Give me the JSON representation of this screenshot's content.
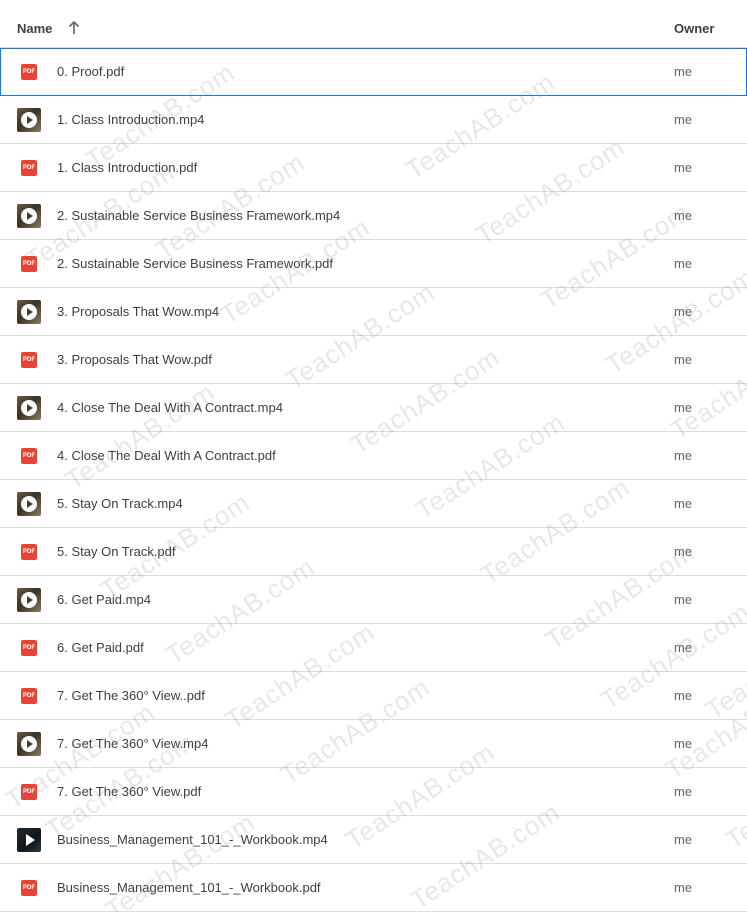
{
  "header": {
    "name_label": "Name",
    "owner_label": "Owner",
    "sort_icon": "arrow-upward-icon"
  },
  "files": [
    {
      "name": "0. Proof.pdf",
      "type": "pdf",
      "owner": "me",
      "selected": true
    },
    {
      "name": "1. Class Introduction.mp4",
      "type": "video",
      "owner": "me"
    },
    {
      "name": "1. Class Introduction.pdf",
      "type": "pdf",
      "owner": "me"
    },
    {
      "name": "2. Sustainable Service Business Framework.mp4",
      "type": "video",
      "owner": "me"
    },
    {
      "name": "2. Sustainable Service Business Framework.pdf",
      "type": "pdf",
      "owner": "me"
    },
    {
      "name": "3. Proposals That Wow.mp4",
      "type": "video",
      "owner": "me"
    },
    {
      "name": "3. Proposals That Wow.pdf",
      "type": "pdf",
      "owner": "me"
    },
    {
      "name": "4. Close The Deal With A Contract.mp4",
      "type": "video",
      "owner": "me"
    },
    {
      "name": "4. Close The Deal With A Contract.pdf",
      "type": "pdf",
      "owner": "me"
    },
    {
      "name": "5. Stay On Track.mp4",
      "type": "video",
      "owner": "me"
    },
    {
      "name": "5. Stay On Track.pdf",
      "type": "pdf",
      "owner": "me"
    },
    {
      "name": "6. Get Paid.mp4",
      "type": "video",
      "owner": "me"
    },
    {
      "name": "6. Get Paid.pdf",
      "type": "pdf",
      "owner": "me"
    },
    {
      "name": "7. Get The 360° View..pdf",
      "type": "pdf",
      "owner": "me"
    },
    {
      "name": "7. Get The 360° View.mp4",
      "type": "video",
      "owner": "me"
    },
    {
      "name": "7. Get The 360° View.pdf",
      "type": "pdf",
      "owner": "me"
    },
    {
      "name": "Business_Management_101_-_Workbook.mp4",
      "type": "video-dark",
      "owner": "me"
    },
    {
      "name": "Business_Management_101_-_Workbook.pdf",
      "type": "pdf",
      "owner": "me"
    }
  ],
  "pdf_badge": "PDF",
  "watermark_text": "TeachAB.com",
  "colors": {
    "selection_border": "#1a73e8",
    "pdf_red": "#ea4335",
    "divider": "#dadce0",
    "text": "#3c4043"
  }
}
